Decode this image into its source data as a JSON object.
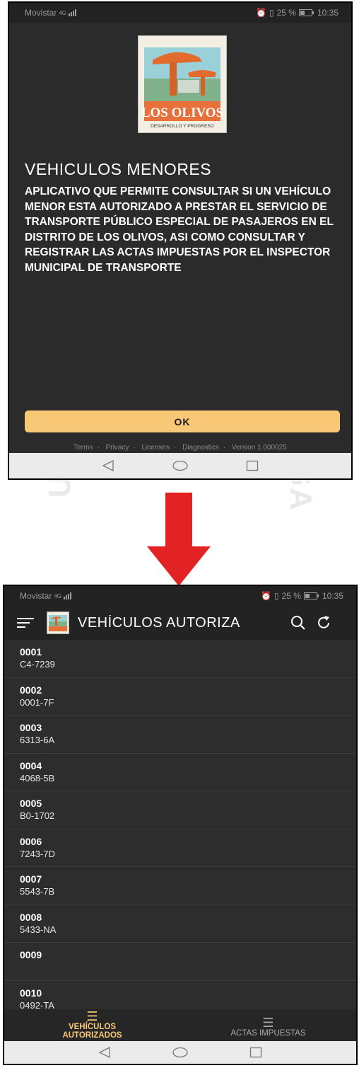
{
  "top_screen": {
    "status": {
      "carrier": "Movistar",
      "network": "4G",
      "battery": "25 %",
      "time": "10:35"
    },
    "logo": {
      "text": "LOS OLIVOS",
      "tagline": "DESARROLLO Y PROGRESO"
    },
    "title": "VEHICULOS MENORES",
    "body": "APLICATIVO QUE PERMITE CONSULTAR SI UN VEHÍCULO MENOR ESTA AUTORIZADO A PRESTAR EL SERVICIO DE TRANSPORTE PÚBLICO ESPECIAL DE PASAJEROS EN EL DISTRITO DE LOS OLIVOS, ASI COMO CONSULTAR Y REGISTRAR LAS ACTAS IMPUESTAS POR EL INSPECTOR MUNICIPAL DE TRANSPORTE",
    "ok_label": "OK",
    "footer": {
      "terms": "Terms",
      "privacy": "Privacy",
      "licenses": "Licenses",
      "diagnostics": "Diagnostics",
      "version": "Version 1.000025"
    }
  },
  "bottom_screen": {
    "status": {
      "carrier": "Movistar",
      "network": "4G",
      "battery": "25 %",
      "time": "10:35"
    },
    "appbar_title": "VEHÍCULOS AUTORIZA",
    "vehicles": [
      {
        "code": "0001",
        "plate": "C4-7239"
      },
      {
        "code": "0002",
        "plate": "0001-7F"
      },
      {
        "code": "0003",
        "plate": "6313-6A"
      },
      {
        "code": "0004",
        "plate": "4068-5B"
      },
      {
        "code": "0005",
        "plate": "B0-1702"
      },
      {
        "code": "0006",
        "plate": "7243-7D"
      },
      {
        "code": "0007",
        "plate": "5543-7B"
      },
      {
        "code": "0008",
        "plate": "5433-NA"
      },
      {
        "code": "0009",
        "plate": ""
      },
      {
        "code": "0010",
        "plate": "0492-TA"
      }
    ],
    "tabs": {
      "authorized_line1": "VEHÍCULOS",
      "authorized_line2": "AUTORIZADOS",
      "fines": "ACTAS IMPUESTAS"
    }
  },
  "watermark": {
    "left": "UNIV",
    "right": "VEGA"
  },
  "colors": {
    "accent": "#f9c877",
    "background": "#2b2b2b",
    "arrow": "#e32323"
  },
  "icons": [
    "menu-icon",
    "search-icon",
    "refresh-icon",
    "back-icon",
    "home-icon",
    "recents-icon",
    "list-icon",
    "arrow-down-icon"
  ]
}
